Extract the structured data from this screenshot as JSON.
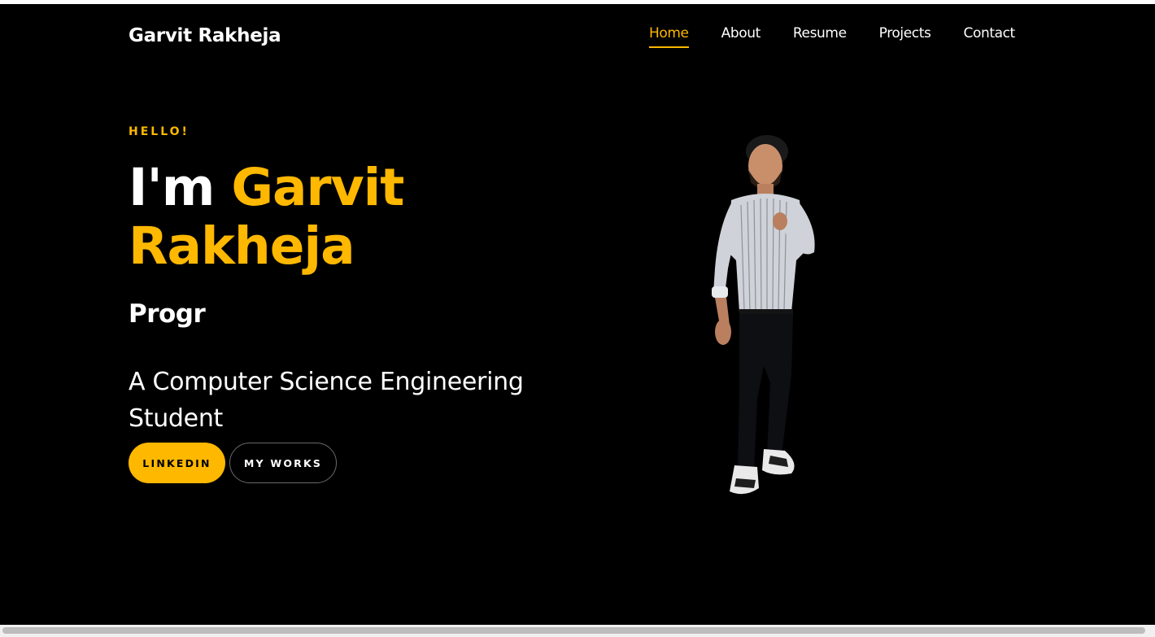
{
  "header": {
    "brand": "Garvit Rakheja",
    "nav": [
      {
        "label": "Home",
        "active": true
      },
      {
        "label": "About",
        "active": false
      },
      {
        "label": "Resume",
        "active": false
      },
      {
        "label": "Projects",
        "active": false
      },
      {
        "label": "Contact",
        "active": false
      }
    ]
  },
  "hero": {
    "greeting": "HELLO!",
    "headline_prefix": "I'm",
    "headline_name_line1": "Garvit",
    "headline_name_line2": "Rakheja",
    "typed_text": "Progr",
    "subtitle": "A Computer Science Engineering Student",
    "buttons": {
      "primary": "LINKEDIN",
      "secondary": "MY WORKS"
    },
    "portrait_icon": "person-portrait-icon"
  },
  "colors": {
    "accent": "#ffb800",
    "background": "#000000",
    "text": "#ffffff"
  }
}
